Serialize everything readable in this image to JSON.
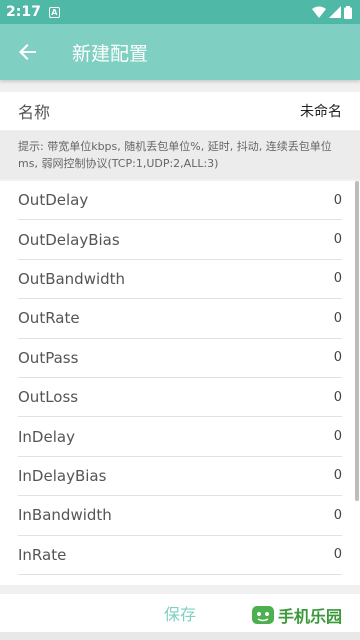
{
  "status_bar": {
    "time": "2:17",
    "notif_letter": "A"
  },
  "app_bar": {
    "title": "新建配置",
    "back_icon": "arrow-back-icon"
  },
  "name_row": {
    "label": "名称",
    "value": "未命名"
  },
  "hint": "提示: 带宽单位kbps, 随机丢包单位%, 延时, 抖动, 连续丢包单位ms, 弱网控制协议(TCP:1,UDP:2,ALL:3)",
  "params": [
    {
      "name": "OutDelay",
      "value": "0"
    },
    {
      "name": "OutDelayBias",
      "value": "0"
    },
    {
      "name": "OutBandwidth",
      "value": "0"
    },
    {
      "name": "OutRate",
      "value": "0"
    },
    {
      "name": "OutPass",
      "value": "0"
    },
    {
      "name": "OutLoss",
      "value": "0"
    },
    {
      "name": "InDelay",
      "value": "0"
    },
    {
      "name": "InDelayBias",
      "value": "0"
    },
    {
      "name": "InBandwidth",
      "value": "0"
    },
    {
      "name": "InRate",
      "value": "0"
    }
  ],
  "save_label": "保存",
  "watermark": {
    "text": "手机乐园"
  },
  "colors": {
    "accent": "#7fd0c2",
    "status": "#4fb8a6"
  }
}
